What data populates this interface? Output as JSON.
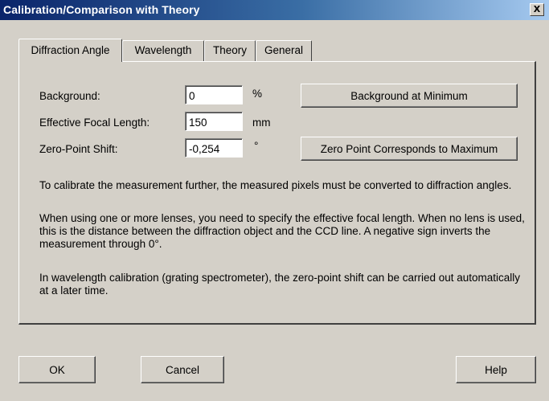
{
  "window": {
    "title": "Calibration/Comparison with Theory",
    "close_label": "X"
  },
  "tabs": [
    {
      "label": "Diffraction Angle",
      "active": true
    },
    {
      "label": "Wavelength",
      "active": false
    },
    {
      "label": "Theory",
      "active": false
    },
    {
      "label": "General",
      "active": false
    }
  ],
  "fields": {
    "background": {
      "label": "Background:",
      "value": "0",
      "unit": "%"
    },
    "focal_length": {
      "label": "Effective Focal Length:",
      "value": "150",
      "unit": "mm"
    },
    "zero_point": {
      "label": "Zero-Point Shift:",
      "value": "-0,254",
      "unit": "°"
    }
  },
  "buttons": {
    "background_min": "Background at Minimum",
    "zero_point_max": "Zero Point Corresponds to Maximum",
    "ok": "OK",
    "cancel": "Cancel",
    "help": "Help"
  },
  "paragraphs": [
    "To calibrate the measurement further, the measured pixels must be converted to diffraction angles.",
    "When using one or more lenses, you need to specify the effective focal length. When no lens is used, this is the distance between the diffraction object and the CCD line. A negative sign inverts the measurement through 0°.",
    "In wavelength calibration (grating spectrometer), the zero-point shift can be carried out automatically at a later time."
  ]
}
